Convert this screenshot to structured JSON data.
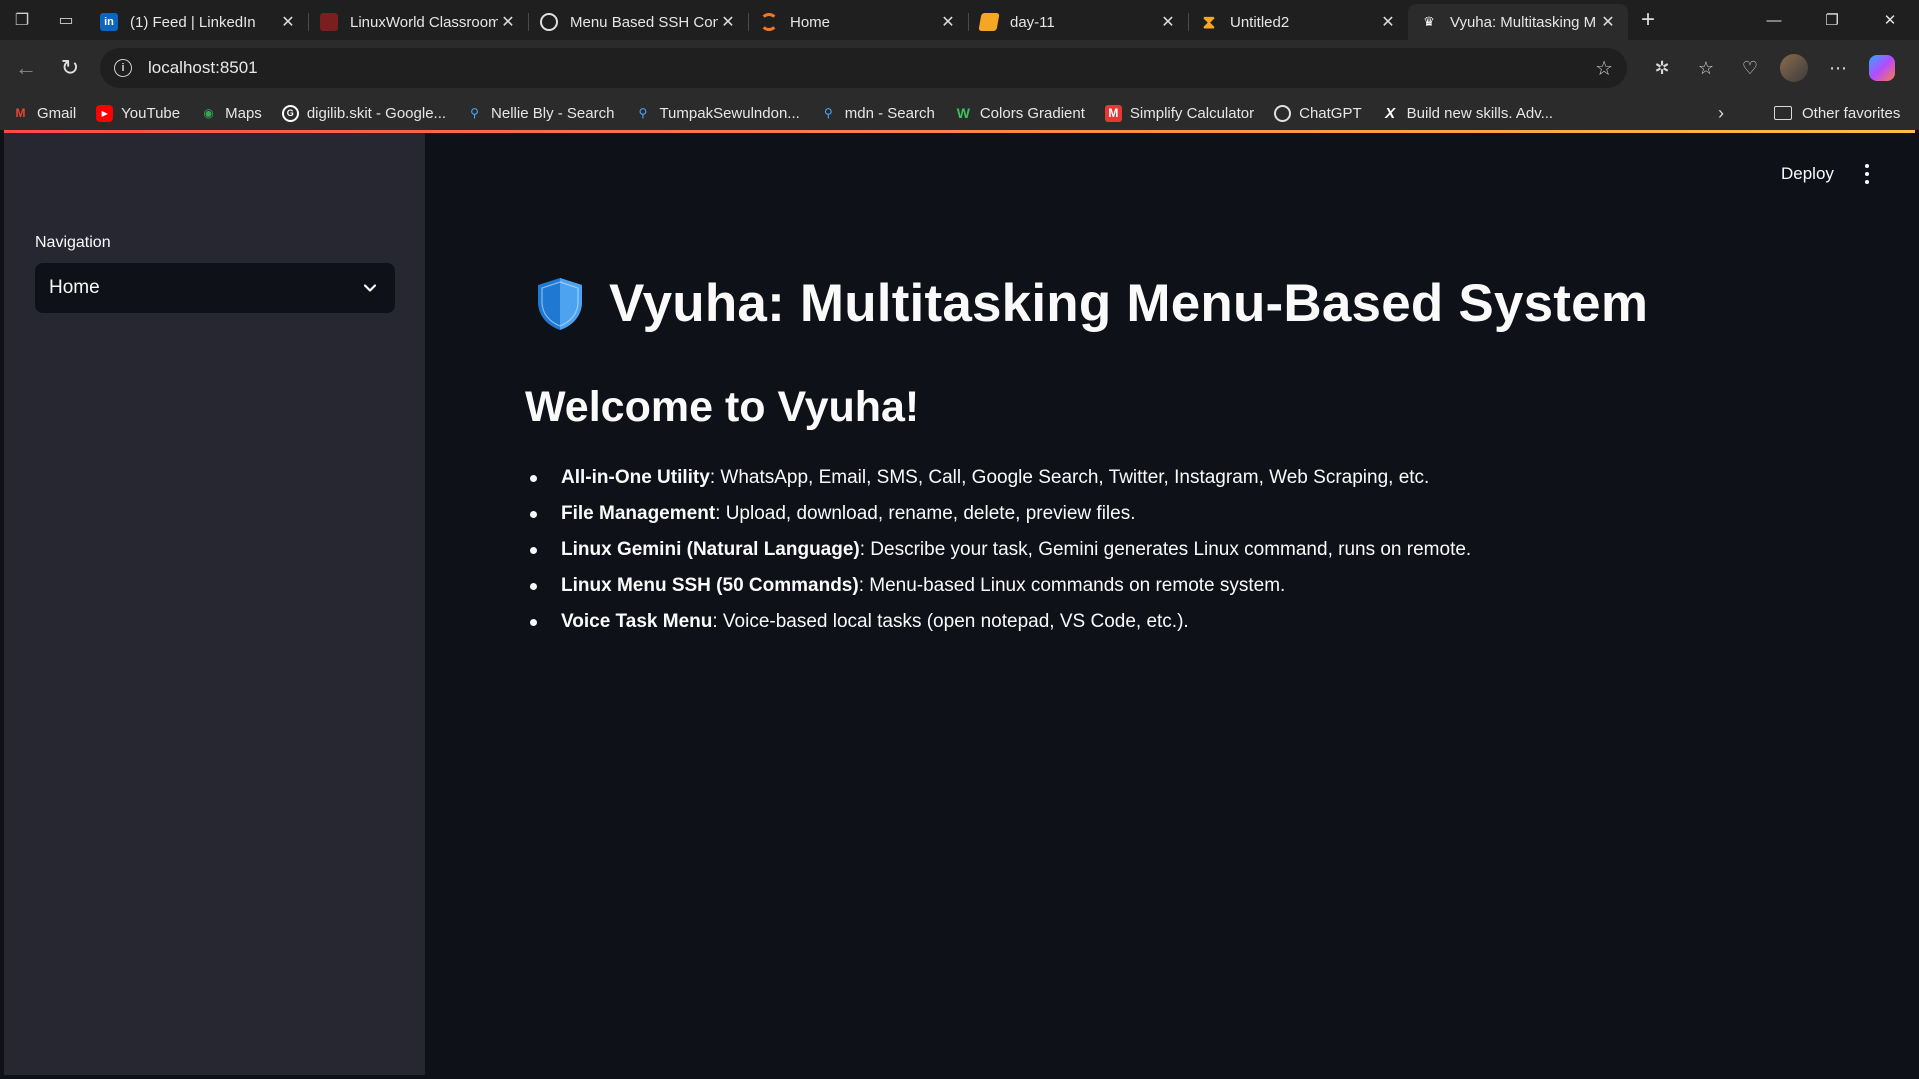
{
  "browser": {
    "tabs": [
      {
        "title": "(1) Feed | LinkedIn",
        "icon": "linkedin-icon",
        "color": "#0a66c2",
        "active": false
      },
      {
        "title": "LinuxWorld Classroom",
        "icon": "linuxworld-icon",
        "color": "#7a1f1f",
        "active": false
      },
      {
        "title": "Menu Based SSH Con",
        "icon": "chatgpt-icon",
        "color": "#3a3a3a",
        "active": false
      },
      {
        "title": "Home",
        "icon": "jupyter-icon",
        "color": "#f37626",
        "active": false
      },
      {
        "title": "day-11",
        "icon": "notebook-icon",
        "color": "#f5a623",
        "active": false
      },
      {
        "title": "Untitled2",
        "icon": "hourglass-icon",
        "color": "#f5a623",
        "active": false
      },
      {
        "title": "Vyuha: Multitasking M",
        "icon": "streamlit-icon",
        "color": "#ffffff",
        "active": true
      }
    ],
    "url": "localhost:8501",
    "bookmarks": [
      {
        "label": "Gmail",
        "icon": "gmail-icon"
      },
      {
        "label": "YouTube",
        "icon": "youtube-icon"
      },
      {
        "label": "Maps",
        "icon": "maps-icon"
      },
      {
        "label": "digilib.skit - Google...",
        "icon": "google-icon"
      },
      {
        "label": "Nellie Bly - Search",
        "icon": "search-icon"
      },
      {
        "label": "TumpakSewulndon...",
        "icon": "search-icon"
      },
      {
        "label": "mdn - Search",
        "icon": "search-icon"
      },
      {
        "label": "Colors Gradient",
        "icon": "gradient-icon"
      },
      {
        "label": "Simplify Calculator",
        "icon": "calculator-icon"
      },
      {
        "label": "ChatGPT",
        "icon": "chatgpt-icon"
      },
      {
        "label": "Build new skills. Adv...",
        "icon": "x-icon"
      }
    ],
    "other_favorites": "Other favorites"
  },
  "sidebar": {
    "label": "Navigation",
    "selected": "Home"
  },
  "header": {
    "deploy": "Deploy"
  },
  "main": {
    "title": "Vyuha: Multitasking Menu-Based System",
    "subtitle": "Welcome to Vyuha!",
    "features": [
      {
        "name": "All-in-One Utility",
        "desc": ": WhatsApp, Email, SMS, Call, Google Search, Twitter, Instagram, Web Scraping, etc."
      },
      {
        "name": "File Management",
        "desc": ": Upload, download, rename, delete, preview files."
      },
      {
        "name": "Linux Gemini (Natural Language)",
        "desc": ": Describe your task, Gemini generates Linux command, runs on remote."
      },
      {
        "name": "Linux Menu SSH (50 Commands)",
        "desc": ": Menu-based Linux commands on remote system."
      },
      {
        "name": "Voice Task Menu",
        "desc": ": Voice-based local tasks (open notepad, VS Code, etc.)."
      }
    ]
  },
  "colors": {
    "app_bg": "#0e1117",
    "sidebar_bg": "#262730",
    "text": "#fafafa",
    "accent_start": "#ff4b4b",
    "accent_end": "#ffbd45"
  }
}
